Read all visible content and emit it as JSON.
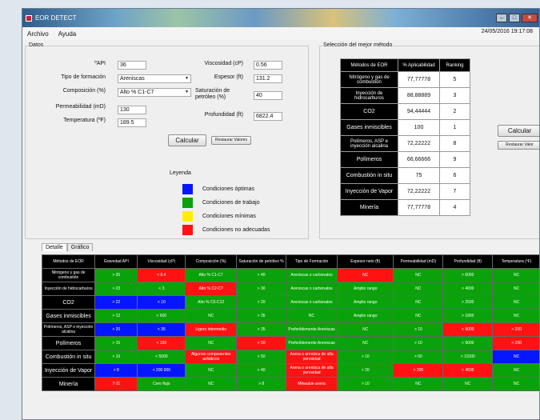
{
  "window": {
    "title": "EOR DETECT"
  },
  "menu": {
    "items": [
      "Archivo",
      "Ayuda"
    ],
    "datetime": "24/05/2016 19:17:08"
  },
  "datos": {
    "label": "Datos",
    "api_label": "ºAPI",
    "api_value": "36",
    "formacion_label": "Tipo de formación",
    "formacion_value": "Areniscas",
    "composicion_label": "Composición (%)",
    "composicion_value": "Alto % C1-C7",
    "permeabilidad_label": "Permeabilidad (mD)",
    "permeabilidad_value": "130",
    "temperatura_label": "Temperatura (ºF)",
    "temperatura_value": "189.5",
    "viscosidad_label": "Viscosidad (cP)",
    "viscosidad_value": "0.56",
    "espesor_label": "Espesor (ft)",
    "espesor_value": "131.2",
    "saturacion_label": "Saturación de petróleo (%)",
    "saturacion_value": "40",
    "profundidad_label": "Profundidad (ft)",
    "profundidad_value": "6822.4",
    "calcular_label": "Calcular",
    "restaurar_label": "Restaurar Valores"
  },
  "leyenda": {
    "title": "Leyenda",
    "items": [
      {
        "label": "Condiciones óptimas",
        "color": "#0616ff"
      },
      {
        "label": "Condiciones de trabajo",
        "color": "#0aa20a"
      },
      {
        "label": "Condiciones mínimas",
        "color": "#ffee00"
      },
      {
        "label": "Condiciones no adecuadas",
        "color": "#ff1212"
      }
    ]
  },
  "seleccion": {
    "title": "Selección del mejor método",
    "headers": [
      "Métodos de EOR",
      "% Aplicabilidad",
      "Ranking"
    ],
    "rows": [
      {
        "metodo": "Nitrógeno y gas de combustión",
        "aplic": "77,77778",
        "rank": "5"
      },
      {
        "metodo": "Inyección de hidrocarburos",
        "aplic": "88,88889",
        "rank": "3"
      },
      {
        "metodo": "CO2",
        "aplic": "94,44444",
        "rank": "2"
      },
      {
        "metodo": "Gases inmiscibles",
        "aplic": "100",
        "rank": "1"
      },
      {
        "metodo": "Polímeros, ASP e inyección alcalina",
        "aplic": "72,22222",
        "rank": "8"
      },
      {
        "metodo": "Polímeros",
        "aplic": "66,66666",
        "rank": "9"
      },
      {
        "metodo": "Combustión in situ",
        "aplic": "75",
        "rank": "6"
      },
      {
        "metodo": "Inyección de Vapor",
        "aplic": "72,22222",
        "rank": "7"
      },
      {
        "metodo": "Minería",
        "aplic": "77,77778",
        "rank": "4"
      }
    ],
    "calcular_label": "Calcular",
    "restaurar_label": "Restaurar Valor"
  },
  "tabs": [
    "Detalle",
    "Gráfico"
  ],
  "detalle": {
    "headers": [
      "Métodos de EOR",
      "Gravedad API",
      "Viscosidad (cP)",
      "Composición (%)",
      "Saturación de petróleo %",
      "Tipo de Formación",
      "Espesor neto (ft)",
      "Permeabilidad (mD)",
      "Profundidad (ft)",
      "Temperatura (ºF)"
    ],
    "rows": [
      {
        "metodo": "Nitrógeno y gas de combustión",
        "cells": [
          [
            "> 35",
            "g"
          ],
          [
            "< 0.4",
            "r"
          ],
          [
            "Alto % C1-C7",
            "g"
          ],
          [
            "> 40",
            "g"
          ],
          [
            "Areniscas o carbonatos",
            "g"
          ],
          [
            "NC",
            "r"
          ],
          [
            "NC",
            "g"
          ],
          [
            "> 6000",
            "g"
          ],
          [
            "NC",
            "g"
          ]
        ]
      },
      {
        "metodo": "Inyección de hidrocarburos",
        "cells": [
          [
            "> 23",
            "g"
          ],
          [
            "< 3",
            "g"
          ],
          [
            "Alto % C2-C7",
            "r"
          ],
          [
            "> 30",
            "g"
          ],
          [
            "Areniscas o carbonatos",
            "g"
          ],
          [
            "Amplio rango",
            "g"
          ],
          [
            "NC",
            "g"
          ],
          [
            "> 4000",
            "g"
          ],
          [
            "NC",
            "g"
          ]
        ]
      },
      {
        "metodo": "CO2",
        "cells": [
          [
            "> 22",
            "b"
          ],
          [
            "< 10",
            "b"
          ],
          [
            "Alto % C5-C12",
            "g"
          ],
          [
            "> 20",
            "g"
          ],
          [
            "Areniscas o carbonatos",
            "g"
          ],
          [
            "Amplio rango",
            "g"
          ],
          [
            "NC",
            "g"
          ],
          [
            "> 2500",
            "g"
          ],
          [
            "NC",
            "g"
          ]
        ]
      },
      {
        "metodo": "Gases inmiscibles",
        "cells": [
          [
            "> 12",
            "g"
          ],
          [
            "< 600",
            "g"
          ],
          [
            "NC",
            "g"
          ],
          [
            "> 35",
            "g"
          ],
          [
            "NC",
            "g"
          ],
          [
            "Amplio rango",
            "g"
          ],
          [
            "NC",
            "g"
          ],
          [
            "> 1800",
            "g"
          ],
          [
            "NC",
            "g"
          ]
        ]
      },
      {
        "metodo": "Polímeros, ASP e inyección alcalina",
        "cells": [
          [
            "> 20",
            "b"
          ],
          [
            "< 35",
            "b"
          ],
          [
            "Ligero intermedio",
            "r"
          ],
          [
            "> 35",
            "g"
          ],
          [
            "Preferiblemente Areniscas",
            "g"
          ],
          [
            "NC",
            "g"
          ],
          [
            "> 10",
            "g"
          ],
          [
            "< 9000",
            "r"
          ],
          [
            "> 200",
            "r"
          ]
        ]
      },
      {
        "metodo": "Polímeros",
        "cells": [
          [
            "> 15",
            "g"
          ],
          [
            "< 150",
            "r"
          ],
          [
            "NC",
            "g"
          ],
          [
            "> 50",
            "r"
          ],
          [
            "Preferiblemente Areniscas",
            "g"
          ],
          [
            "NC",
            "g"
          ],
          [
            "> 10",
            "g"
          ],
          [
            "< 9000",
            "g"
          ],
          [
            "> 200",
            "r"
          ]
        ]
      },
      {
        "metodo": "Combustión in situ",
        "cells": [
          [
            "> 10",
            "g"
          ],
          [
            "< 5000",
            "g"
          ],
          [
            "Algunos componentes asfálticos",
            "r"
          ],
          [
            "> 50",
            "g"
          ],
          [
            "Arena o arenisca de alta porosidad",
            "r"
          ],
          [
            "> 10",
            "g"
          ],
          [
            "> 50",
            "g"
          ],
          [
            "< 11500",
            "g"
          ],
          [
            "NC",
            "b"
          ]
        ]
      },
      {
        "metodo": "Inyección de Vapor",
        "cells": [
          [
            "> 8",
            "b"
          ],
          [
            "< 200 000",
            "b"
          ],
          [
            "NC",
            "g"
          ],
          [
            "> 40",
            "g"
          ],
          [
            "Arena o arenisca de alta porosidad",
            "r"
          ],
          [
            "> 20",
            "g"
          ],
          [
            "> 200",
            "r"
          ],
          [
            "< 4500",
            "r"
          ],
          [
            "NC",
            "g"
          ]
        ]
      },
      {
        "metodo": "Minería",
        "cells": [
          [
            "7-11",
            "r"
          ],
          [
            "Cero flujo",
            "g"
          ],
          [
            "NC",
            "g"
          ],
          [
            "> 8",
            "g"
          ],
          [
            "Mineable arena",
            "r"
          ],
          [
            "> 10",
            "g"
          ],
          [
            "NC",
            "g"
          ],
          [
            "NC",
            "g"
          ],
          [
            "NC",
            "g"
          ]
        ]
      }
    ]
  }
}
